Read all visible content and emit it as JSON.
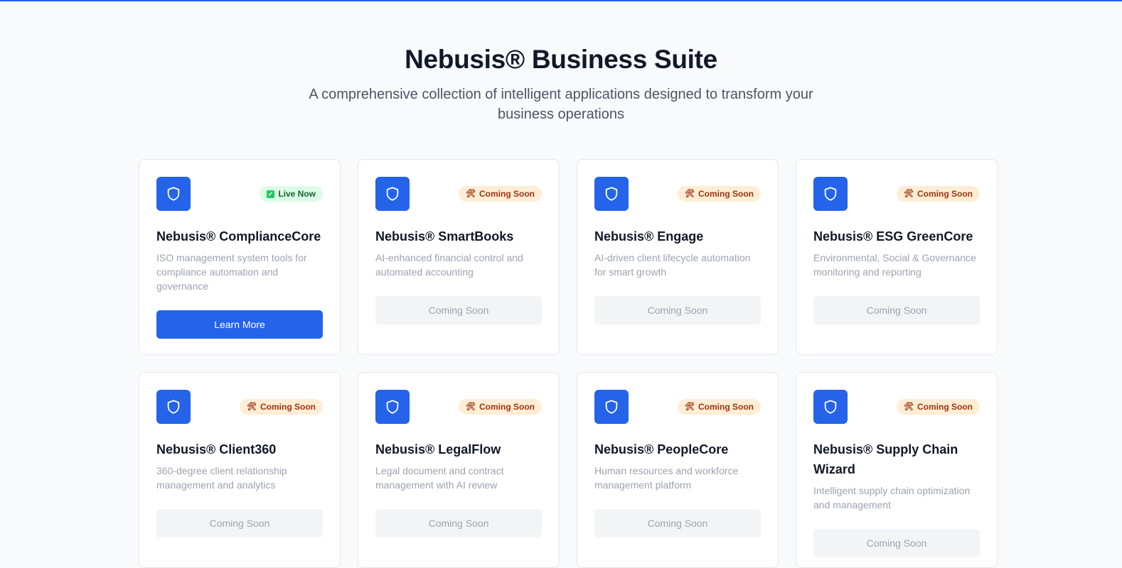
{
  "header": {
    "title": "Nebusis® Business Suite",
    "subtitle": "A comprehensive collection of intelligent applications designed to transform your business operations"
  },
  "colors": {
    "accent": "#2563eb",
    "live_bg": "#dcfce7",
    "soon_bg": "#ffedd5"
  },
  "apps": [
    {
      "name": "Nebusis® ComplianceCore",
      "description": "ISO management system tools for compliance automation and governance",
      "badge": "Live Now",
      "badge_icon": "check-icon",
      "status": "live",
      "button": "Learn More"
    },
    {
      "name": "Nebusis® SmartBooks",
      "description": "AI-enhanced financial control and automated accounting",
      "badge": "Coming Soon",
      "badge_icon": "tools-icon",
      "status": "soon",
      "button": "Coming Soon"
    },
    {
      "name": "Nebusis® Engage",
      "description": "AI-driven client lifecycle automation for smart growth",
      "badge": "Coming Soon",
      "badge_icon": "tools-icon",
      "status": "soon",
      "button": "Coming Soon"
    },
    {
      "name": "Nebusis® ESG GreenCore",
      "description": "Environmental, Social & Governance monitoring and reporting",
      "badge": "Coming Soon",
      "badge_icon": "tools-icon",
      "status": "soon",
      "button": "Coming Soon"
    },
    {
      "name": "Nebusis® Client360",
      "description": "360-degree client relationship management and analytics",
      "badge": "Coming Soon",
      "badge_icon": "tools-icon",
      "status": "soon",
      "button": "Coming Soon"
    },
    {
      "name": "Nebusis® LegalFlow",
      "description": "Legal document and contract management with AI review",
      "badge": "Coming Soon",
      "badge_icon": "tools-icon",
      "status": "soon",
      "button": "Coming Soon"
    },
    {
      "name": "Nebusis® PeopleCore",
      "description": "Human resources and workforce management platform",
      "badge": "Coming Soon",
      "badge_icon": "tools-icon",
      "status": "soon",
      "button": "Coming Soon"
    },
    {
      "name": "Nebusis® Supply Chain Wizard",
      "description": "Intelligent supply chain optimization and management",
      "badge": "Coming Soon",
      "badge_icon": "tools-icon",
      "status": "soon",
      "button": "Coming Soon"
    }
  ]
}
